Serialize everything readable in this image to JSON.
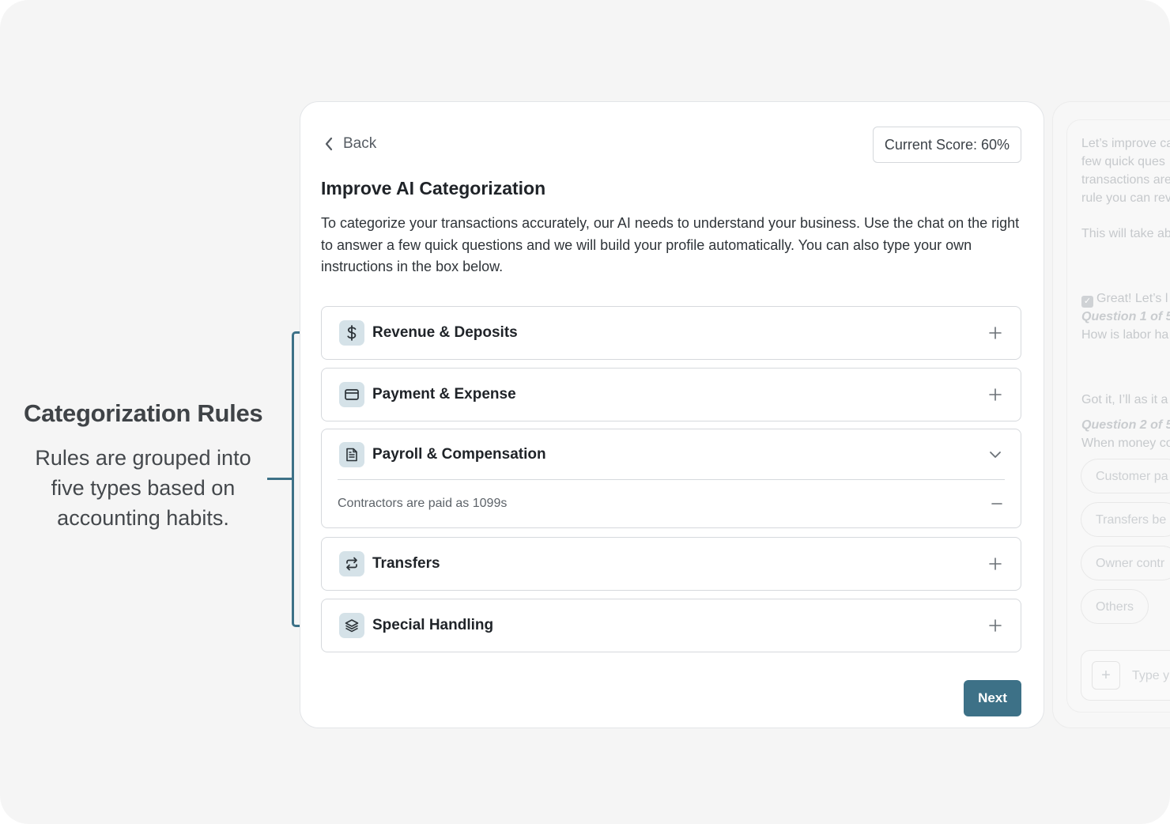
{
  "annotation": {
    "title": "Categorization Rules",
    "description": "Rules are grouped into five types based on accounting habits."
  },
  "header": {
    "back_label": "Back",
    "score_label": "Current Score: 60%"
  },
  "main": {
    "title": "Improve AI Categorization",
    "description": "To categorize your transactions accurately, our AI needs to understand your business. Use the chat on the right to answer a few quick questions and we will build your profile automatically. You can also type your own instructions in the box below."
  },
  "categories": [
    {
      "label": "Revenue & Deposits",
      "icon": "dollar-icon",
      "state": "collapsed"
    },
    {
      "label": "Payment & Expense",
      "icon": "credit-card-icon",
      "state": "collapsed"
    },
    {
      "label": "Payroll & Compensation",
      "icon": "document-icon",
      "state": "expanded",
      "rules": [
        "Contractors are paid as 1099s"
      ]
    },
    {
      "label": "Transfers",
      "icon": "transfer-arrows-icon",
      "state": "collapsed"
    },
    {
      "label": "Special Handling",
      "icon": "layers-icon",
      "state": "collapsed"
    }
  ],
  "footer": {
    "next_label": "Next"
  },
  "chat": {
    "intro_lines": [
      "Let’s improve ca",
      "few quick ques",
      "transactions are",
      "rule you can rev"
    ],
    "time_note": "This will take ab",
    "ack": "Great! Let’s l",
    "q1_label": "Question 1 of 5",
    "q1_text": "How is labor ha",
    "reply": "Got it, I’ll as it a",
    "q2_label": "Question 2 of 5",
    "q2_text": "When money co",
    "options": [
      "Customer pa",
      "Transfers be",
      "Owner contr",
      "Others"
    ],
    "input_placeholder": "Type y"
  },
  "colors": {
    "accent": "#3d7187",
    "icon_bg": "#d5e2e8",
    "border": "#d6d9dd"
  }
}
